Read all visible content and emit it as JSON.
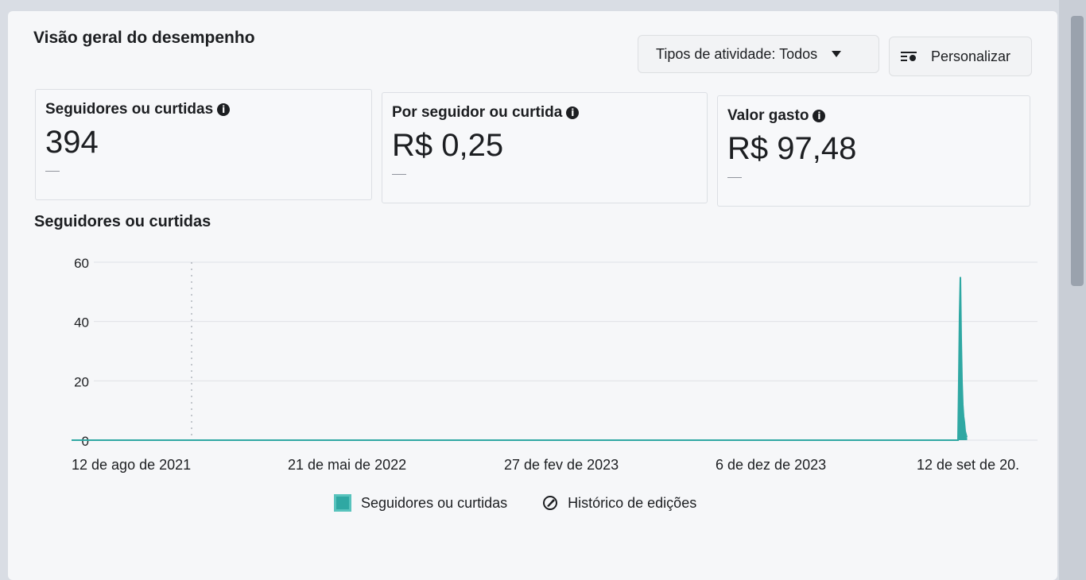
{
  "header": {
    "title": "Visão geral do desempenho",
    "activity_filter": "Tipos de atividade: Todos",
    "customize_label": "Personalizar"
  },
  "metrics": [
    {
      "label": "Seguidores ou curtidas",
      "value": "394",
      "trend": "—"
    },
    {
      "label": "Por seguidor ou curtida",
      "value": "R$ 0,25",
      "trend": "—"
    },
    {
      "label": "Valor gasto",
      "value": "R$ 97,48",
      "trend": "—"
    }
  ],
  "chart_title": "Seguidores ou curtidas",
  "chart_data": {
    "type": "line",
    "title": "Seguidores ou curtidas",
    "xlabel": "",
    "ylabel": "",
    "ylim": [
      0,
      60
    ],
    "yticks": [
      0,
      20,
      40,
      60
    ],
    "xticks": [
      "12 de ago de 2021",
      "21 de mai de 2022",
      "27 de fev de 2023",
      "6 de dez de 2023",
      "12 de set de 20..."
    ],
    "series": [
      {
        "name": "Seguidores ou curtidas",
        "color": "#2fa8a3",
        "x": [
          "2021-08-12",
          "2024-09-01",
          "2024-09-02",
          "2024-09-03",
          "2024-09-04",
          "2024-09-05",
          "2024-09-06",
          "2024-09-07",
          "2024-09-08",
          "2024-09-09",
          "2024-09-10",
          "2024-09-11",
          "2024-09-12"
        ],
        "y": [
          0,
          0,
          20,
          42,
          55,
          34,
          20,
          12,
          8,
          6,
          3,
          2,
          1
        ]
      }
    ],
    "grid": true,
    "legend": "bottom"
  },
  "legend": {
    "series_label": "Seguidores ou curtidas",
    "edits_label": "Histórico de edições"
  },
  "colors": {
    "series": "#2fa8a3",
    "panel": "#f6f7f9"
  },
  "icons": {
    "info": "info-icon",
    "caret": "caret-down-icon",
    "customize": "sliders-icon",
    "edit_history": "pencil-icon"
  }
}
